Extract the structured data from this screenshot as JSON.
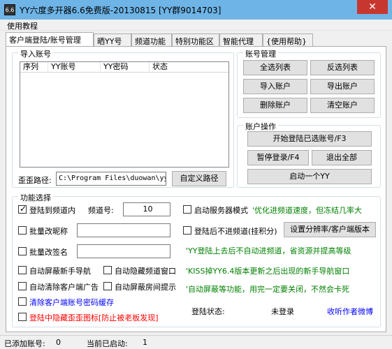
{
  "window": {
    "title": "YY六度多开器6.6免费版-20130815 [YY群9014703]",
    "icon_text": "6.6",
    "close": "✕"
  },
  "menu": {
    "help": "使用教程"
  },
  "tabs": [
    "客户端登陆/账号管理",
    "晒YY号",
    "频道功能",
    "特别功能区",
    "智能代理",
    "{使用帮助}"
  ],
  "import": {
    "title": "导入账号",
    "columns": [
      "序列",
      "YY账号",
      "YY密码",
      "状态"
    ],
    "path_label": "歪歪路径:",
    "path_value": "C:\\Program Files\\duowan\\yy\\",
    "custom_path": "自定义路径"
  },
  "account_mgmt": {
    "title": "账号管理",
    "buttons": [
      "全选列表",
      "反选列表",
      "导入账户",
      "导出账户",
      "删除账户",
      "清空账户"
    ]
  },
  "account_ops": {
    "title": "账户操作",
    "login_selected": "开始登陆已选账号/F3",
    "pause_login": "暂停登录/F4",
    "logout_all": "退出全部",
    "launch_one": "启动一个YY"
  },
  "features": {
    "title": "功能选择",
    "login_channel": "登陆到频道内",
    "channel_label": "频道号:",
    "channel_value": "10",
    "start_server": "启动服务器模式",
    "server_tip": "'优化进频道速度，但冻结几率大",
    "batch_nickname": "批量改昵称",
    "no_enter_channel": "登陆后不进频道(挂积分)",
    "set_resolution": "设置分辨率/客户端版本",
    "batch_signature": "批量改签名",
    "yy_tip": "'YY登陆上去后不自动进频道，省资源并提高等级",
    "auto_block_newbie": "自动屏蔽新手导航",
    "auto_hide_channel": "自动隐藏频道窗口",
    "kiss_tip": "'KISS掉YY6.4版本更新之后出现的新手导航窗口",
    "auto_clear_ads": "自动清除客户端广告",
    "auto_block_room": "自动屏蔽房间提示",
    "auto_block_tip": "'自动屏蔽等功能，用完一定要关闭，不然会卡死",
    "clear_cache": "清除客户端账号密码缓存",
    "hide_icon": "登陆中隐藏歪歪图标[防止被老板发现]",
    "login_status_label": "登陆状态:",
    "login_status_value": "未登录",
    "author_weibo": "收听作者微博"
  },
  "status": {
    "added_label": "已添加账号:",
    "added_value": "0",
    "started_label": "当前已启动:",
    "started_value": "1"
  }
}
